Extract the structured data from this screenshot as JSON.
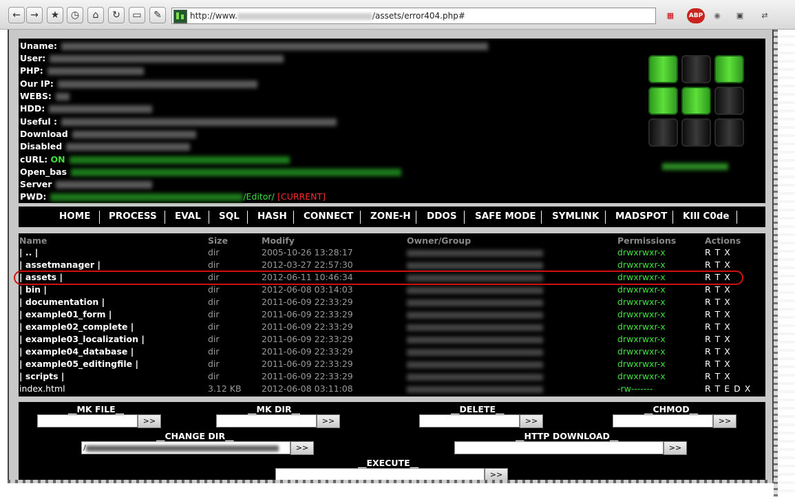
{
  "browser": {
    "url_prefix": "http://www.",
    "url_suffix": "/assets/error404.php#",
    "addon_abp": "ABP"
  },
  "info": {
    "labels": [
      "Uname:",
      "User:",
      "PHP:",
      "Our IP:",
      "WEBS:",
      "HDD:",
      "Useful :",
      "Download",
      "Disabled",
      "cURL:",
      "Open_bas",
      "Server",
      "PWD:"
    ],
    "curl_status": "ON",
    "pwd_tail": "/Editor/",
    "pwd_current": "[CURRENT]"
  },
  "nav": [
    "HOME",
    "PROCESS",
    "EVAL",
    "SQL",
    "HASH",
    "CONNECT",
    "ZONE-H",
    "DDOS",
    "SAFE MODE",
    "SYMLINK",
    "MADSPOT",
    "KIll C0de"
  ],
  "files": {
    "headers": [
      "Name",
      "Size",
      "Modify",
      "Owner/Group",
      "Permissions",
      "Actions"
    ],
    "rows": [
      {
        "name": "| .. |",
        "size": "dir",
        "modify": "2005-10-26 13:28:17",
        "perm": "drwxrwxr-x",
        "actions": "R T X"
      },
      {
        "name": "| assetmanager |",
        "size": "dir",
        "modify": "2012-03-27 22:57:30",
        "perm": "drwxrwxr-x",
        "actions": "R T X"
      },
      {
        "name": "| assets |",
        "size": "dir",
        "modify": "2012-06-11 10:46:34",
        "perm": "drwxrwxr-x",
        "actions": "R T X"
      },
      {
        "name": "| bin |",
        "size": "dir",
        "modify": "2012-06-08 03:14:03",
        "perm": "drwxrwxr-x",
        "actions": "R T X"
      },
      {
        "name": "| documentation |",
        "size": "dir",
        "modify": "2011-06-09 22:33:29",
        "perm": "drwxrwxr-x",
        "actions": "R T X"
      },
      {
        "name": "| example01_form |",
        "size": "dir",
        "modify": "2011-06-09 22:33:29",
        "perm": "drwxrwxr-x",
        "actions": "R T X"
      },
      {
        "name": "| example02_complete |",
        "size": "dir",
        "modify": "2011-06-09 22:33:29",
        "perm": "drwxrwxr-x",
        "actions": "R T X"
      },
      {
        "name": "| example03_localization |",
        "size": "dir",
        "modify": "2011-06-09 22:33:29",
        "perm": "drwxrwxr-x",
        "actions": "R T X"
      },
      {
        "name": "| example04_database |",
        "size": "dir",
        "modify": "2011-06-09 22:33:29",
        "perm": "drwxrwxr-x",
        "actions": "R T X"
      },
      {
        "name": "| example05_editingfile |",
        "size": "dir",
        "modify": "2011-06-09 22:33:29",
        "perm": "drwxrwxr-x",
        "actions": "R T X"
      },
      {
        "name": "| scripts |",
        "size": "dir",
        "modify": "2011-06-09 22:33:29",
        "perm": "drwxrwxr-x",
        "actions": "R T X"
      },
      {
        "name": "index.html",
        "size": "3.12 KB",
        "modify": "2012-06-08 03:11:08",
        "perm": "-rw-------",
        "actions": "R T E D X"
      }
    ]
  },
  "tools": {
    "mk_file": "__MK FILE__",
    "mk_dir": "__MK DIR__",
    "delete": "__DELETE__",
    "chmod": "__CHMOD__",
    "change_dir": "__CHANGE DIR__",
    "http_download": "__HTTP DOWNLOAD__",
    "execute": "__EXECUTE__",
    "go": ">>",
    "change_dir_value": "/"
  },
  "colors": {
    "highlight": "#d01010",
    "green": "#3ee03e",
    "current": "#ff2a2a"
  }
}
